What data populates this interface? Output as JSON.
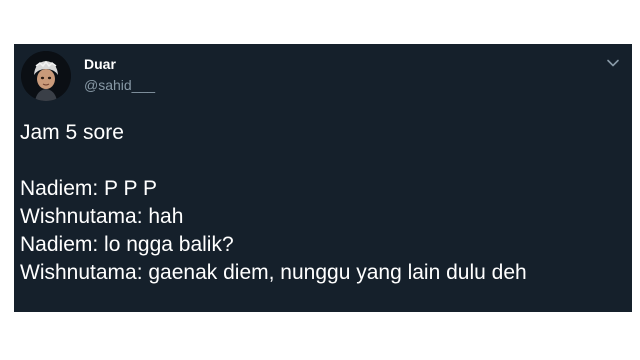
{
  "tweet": {
    "author": {
      "display_name": "Duar",
      "handle": "@sahid___",
      "avatar_icon": "avatar-character-icon"
    },
    "menu_icon": "chevron-down-icon",
    "lines": [
      "Jam 5 sore",
      "",
      "Nadiem: P P P",
      "Wishnutama: hah",
      "Nadiem: lo ngga balik?",
      "Wishnutama: gaenak diem, nunggu yang lain dulu deh"
    ]
  },
  "colors": {
    "card_background": "#15202b",
    "page_background": "#ffffff",
    "text_primary": "#ffffff",
    "text_secondary": "#8899a6"
  }
}
